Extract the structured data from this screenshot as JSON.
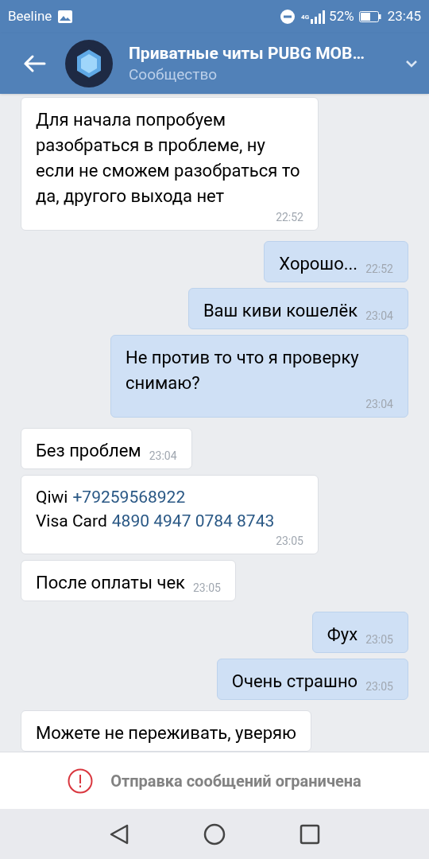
{
  "status_bar": {
    "carrier": "Beeline",
    "network": "4G",
    "battery": "52%",
    "time": "23:45"
  },
  "header": {
    "title": "Приватные читы PUBG MOB…",
    "subtitle": "Сообщество"
  },
  "messages": [
    {
      "kind": "incoming",
      "text": "Для начала попробуем разобраться в проблеме, ну если не сможем разобраться то да, другого выхода нет",
      "time": "22:52"
    },
    {
      "kind": "outgoing",
      "text": "Хорошо...",
      "time": "22:52"
    },
    {
      "kind": "outgoing",
      "text": "Ваш киви кошелёк",
      "time": "23:04"
    },
    {
      "kind": "outgoing",
      "text": "Не против то что я проверку снимаю?",
      "time": "23:04"
    },
    {
      "kind": "incoming",
      "text": "Без проблем",
      "time": "23:04"
    },
    {
      "kind": "incoming",
      "lines": [
        {
          "label": "Qiwi",
          "link": "+79259568922"
        },
        {
          "label": "Visa Card",
          "link": "4890 4947 0784 8743"
        }
      ],
      "time": "23:05"
    },
    {
      "kind": "incoming",
      "text": "После оплаты чек",
      "time": "23:05"
    },
    {
      "kind": "outgoing",
      "text": "Фух",
      "time": "23:05"
    },
    {
      "kind": "outgoing",
      "text": "Очень страшно",
      "time": "23:05"
    },
    {
      "kind": "incoming",
      "text": "Можете не переживать, уверяю"
    }
  ],
  "footer": {
    "notice": "Отправка сообщений ограничена"
  }
}
